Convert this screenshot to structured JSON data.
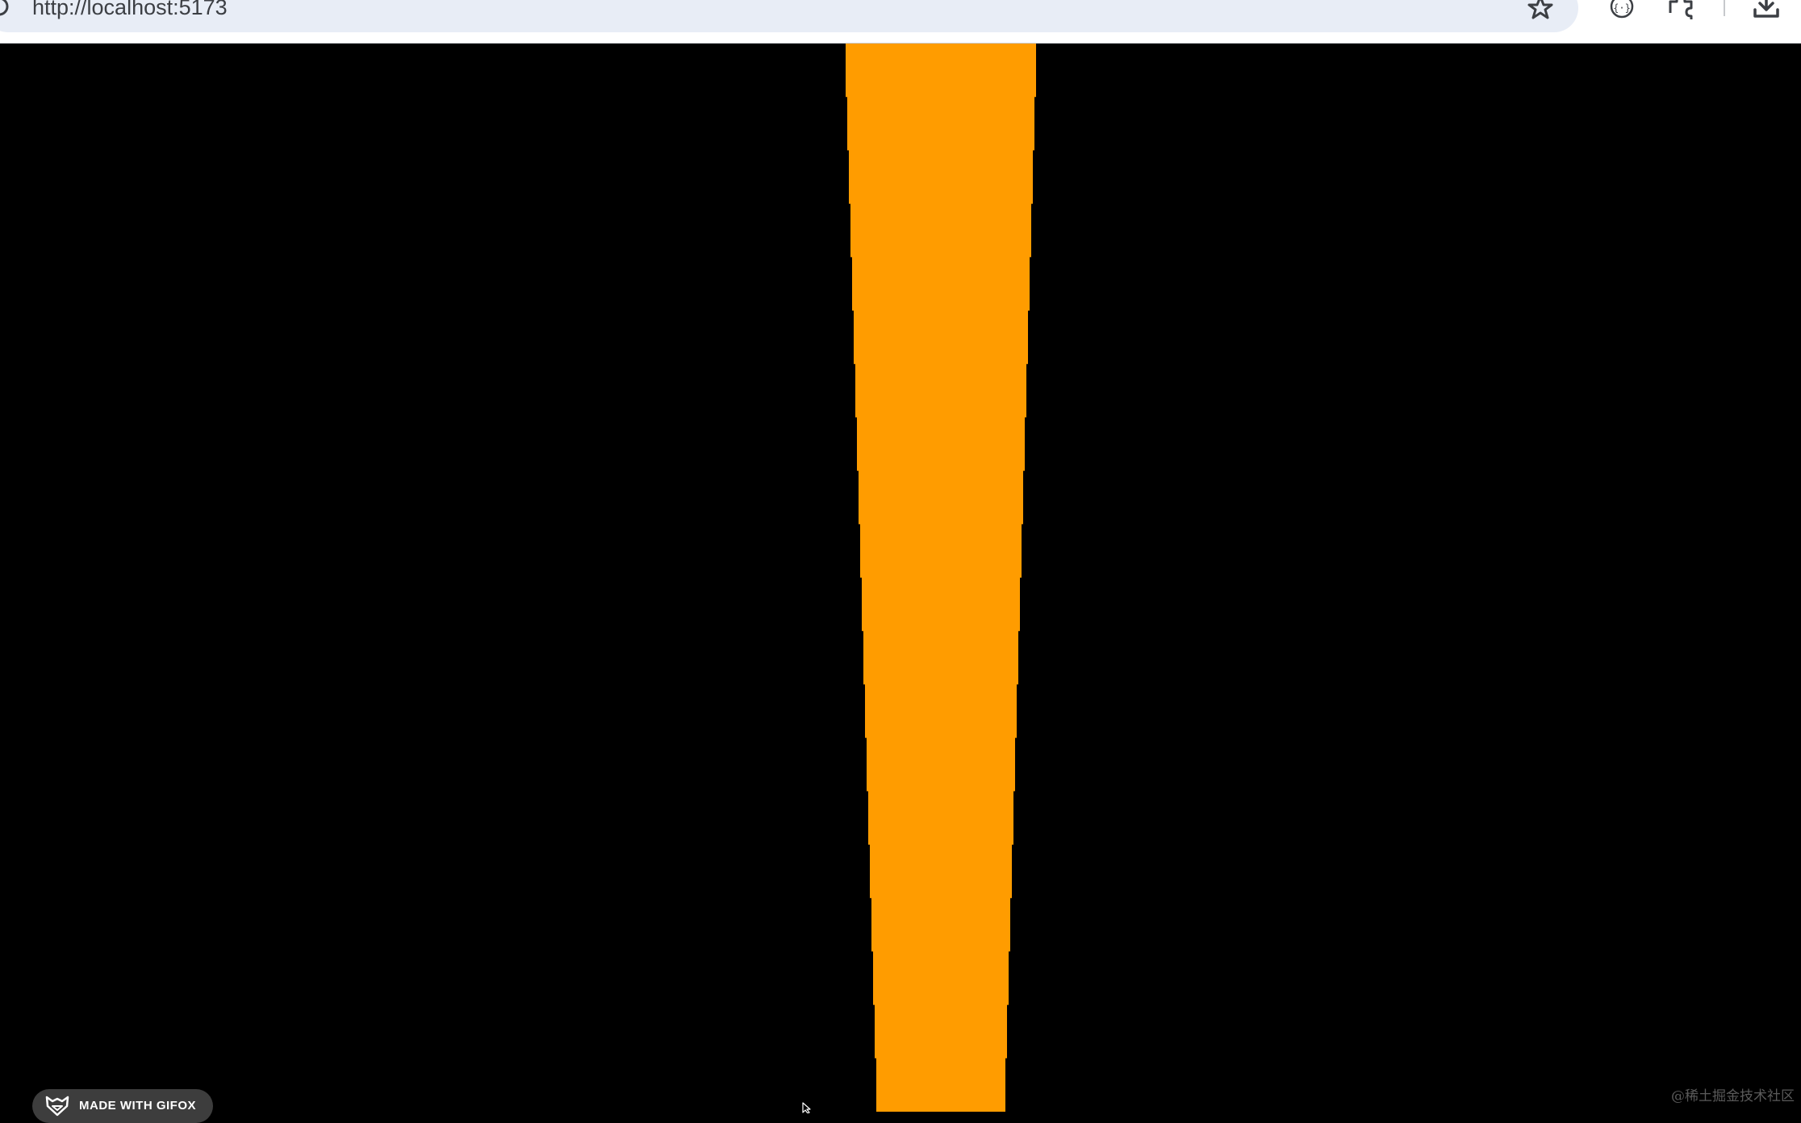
{
  "browser": {
    "url": "http://localhost:5173",
    "icons": [
      "site-info-icon",
      "bookmark-star-icon",
      "extension-icon",
      "extensions-puzzle-icon",
      "download-icon"
    ]
  },
  "page": {
    "background_color": "#000000",
    "beam_color": "#FF9C00"
  },
  "badge": {
    "label": "MADE WITH GIFOX"
  },
  "watermark": {
    "text": "@稀土掘金技术社区"
  }
}
